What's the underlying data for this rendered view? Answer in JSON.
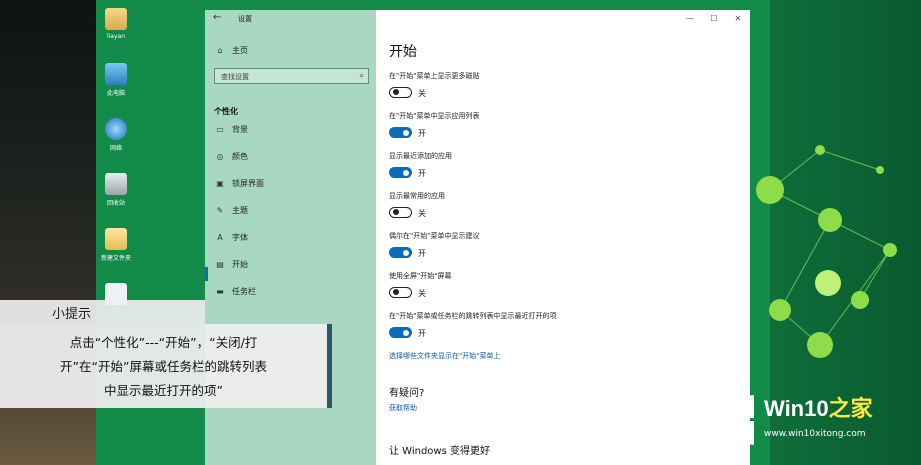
{
  "desktop": {
    "icons": [
      {
        "label": "liayan",
        "icon": "user-folder-icon"
      },
      {
        "label": "此电脑",
        "icon": "computer-icon"
      },
      {
        "label": "网络",
        "icon": "network-icon"
      },
      {
        "label": "回收站",
        "icon": "recycle-bin-icon"
      },
      {
        "label": "新建文件夹",
        "icon": "folder-icon"
      }
    ]
  },
  "window": {
    "title": "设置",
    "back_icon": "back-arrow-icon",
    "controls": [
      "—",
      "☐",
      "✕"
    ]
  },
  "nav": {
    "home": "主页",
    "search_placeholder": "查找设置",
    "section": "个性化",
    "items": [
      {
        "label": "背景",
        "icon": "picture-icon"
      },
      {
        "label": "颜色",
        "icon": "palette-icon"
      },
      {
        "label": "锁屏界面",
        "icon": "lock-screen-icon"
      },
      {
        "label": "主题",
        "icon": "brush-icon"
      },
      {
        "label": "字体",
        "icon": "font-icon"
      },
      {
        "label": "开始",
        "icon": "start-icon"
      },
      {
        "label": "任务栏",
        "icon": "taskbar-icon"
      }
    ],
    "active": "开始"
  },
  "content": {
    "title": "开始",
    "options": [
      {
        "label": "在\"开始\"菜单上显示更多磁贴",
        "state": "off",
        "state_text": "关"
      },
      {
        "label": "在\"开始\"菜单中显示应用列表",
        "state": "on",
        "state_text": "开"
      },
      {
        "label": "显示最近添加的应用",
        "state": "on",
        "state_text": "开"
      },
      {
        "label": "显示最常用的应用",
        "state": "off",
        "state_text": "关"
      },
      {
        "label": "偶尔在\"开始\"菜单中显示建议",
        "state": "on",
        "state_text": "开"
      },
      {
        "label": "使用全屏\"开始\"屏幕",
        "state": "off",
        "state_text": "关"
      },
      {
        "label": "在\"开始\"菜单或任务栏的跳转列表中显示最近打开的项",
        "state": "on",
        "state_text": "开"
      }
    ],
    "folders_link": "选择哪些文件夹显示在\"开始\"菜单上",
    "question_heading": "有疑问?",
    "help_link": "获取帮助",
    "better_heading": "让 Windows 变得更好"
  },
  "tip": {
    "heading": "小提示",
    "lines": [
      "点击“个性化”---“开始”，“关闭/打",
      "开”在“开始”屏幕或任务栏的跳转列表",
      "中显示最近打开的项”"
    ]
  },
  "watermark": {
    "title_latin": "Win10",
    "title_cn": "之家",
    "url": "www.win10xitong.com"
  },
  "colors": {
    "accent": "#0b6bb5",
    "nav_bg": "#a8d7c2",
    "desktop_green": "#128a48"
  }
}
